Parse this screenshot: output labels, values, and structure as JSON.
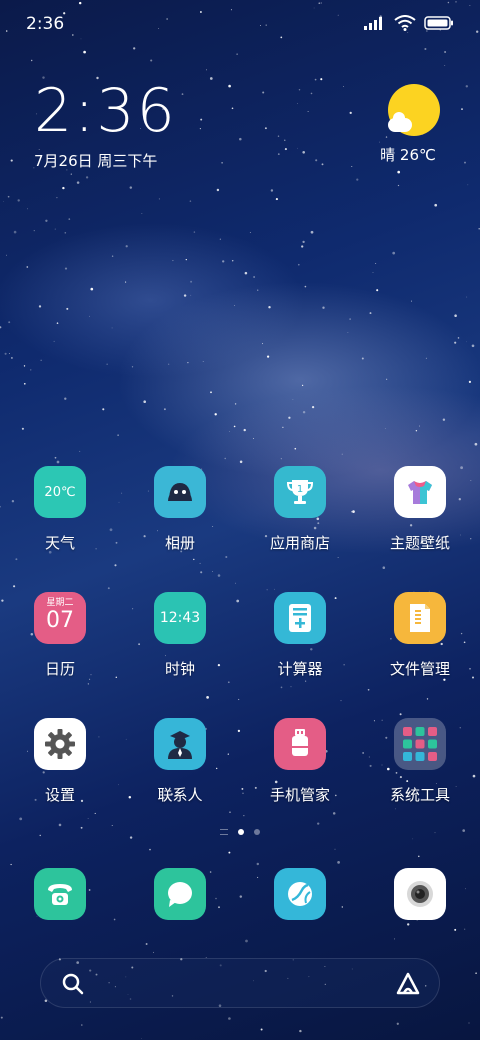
{
  "status_bar": {
    "time": "2:36"
  },
  "clock_widget": {
    "time": "2:36",
    "date": "7月26日 周三下午"
  },
  "weather_widget": {
    "text": "晴 26℃"
  },
  "apps": [
    {
      "name": "weather-app",
      "label": "天气",
      "icon_text": "20℃",
      "color": "#2cc7b4",
      "icon": "weather-icon"
    },
    {
      "name": "gallery-app",
      "label": "相册",
      "color": "#3bb7d6",
      "icon": "gallery-icon"
    },
    {
      "name": "app-store-app",
      "label": "应用商店",
      "color": "#35b9cf",
      "icon": "trophy-icon",
      "icon_text": "1"
    },
    {
      "name": "themes-app",
      "label": "主题壁纸",
      "color": "#ffffff",
      "icon": "shirt-icon"
    },
    {
      "name": "calendar-app",
      "label": "日历",
      "icon_top": "星期二",
      "icon_text": "07",
      "color": "#e45d86",
      "icon": "calendar-icon"
    },
    {
      "name": "clock-app",
      "label": "时钟",
      "icon_text": "12:43",
      "color": "#2bc3b3",
      "icon": "clock-icon"
    },
    {
      "name": "calculator-app",
      "label": "计算器",
      "color": "#34b8d6",
      "icon": "calculator-icon"
    },
    {
      "name": "file-manager-app",
      "label": "文件管理",
      "color": "#f6b73c",
      "icon": "folder-icon"
    },
    {
      "name": "settings-app",
      "label": "设置",
      "color": "#ffffff",
      "icon": "gear-icon"
    },
    {
      "name": "contacts-app",
      "label": "联系人",
      "color": "#36b6d8",
      "icon": "contact-icon"
    },
    {
      "name": "security-app",
      "label": "手机管家",
      "color": "#e45d86",
      "icon": "usb-shield-icon"
    },
    {
      "name": "system-tools-folder",
      "label": "系统工具",
      "color": "rgba(255,255,255,0.25)",
      "icon": "folder-grid-icon"
    }
  ],
  "dock": [
    {
      "name": "phone-app",
      "color": "#2dc49c",
      "icon": "phone-icon"
    },
    {
      "name": "messages-app",
      "color": "#2dc49c",
      "icon": "message-icon"
    },
    {
      "name": "browser-app",
      "color": "#34b7d9",
      "icon": "browser-icon"
    },
    {
      "name": "camera-app",
      "color": "#ffffff",
      "icon": "camera-icon"
    }
  ]
}
